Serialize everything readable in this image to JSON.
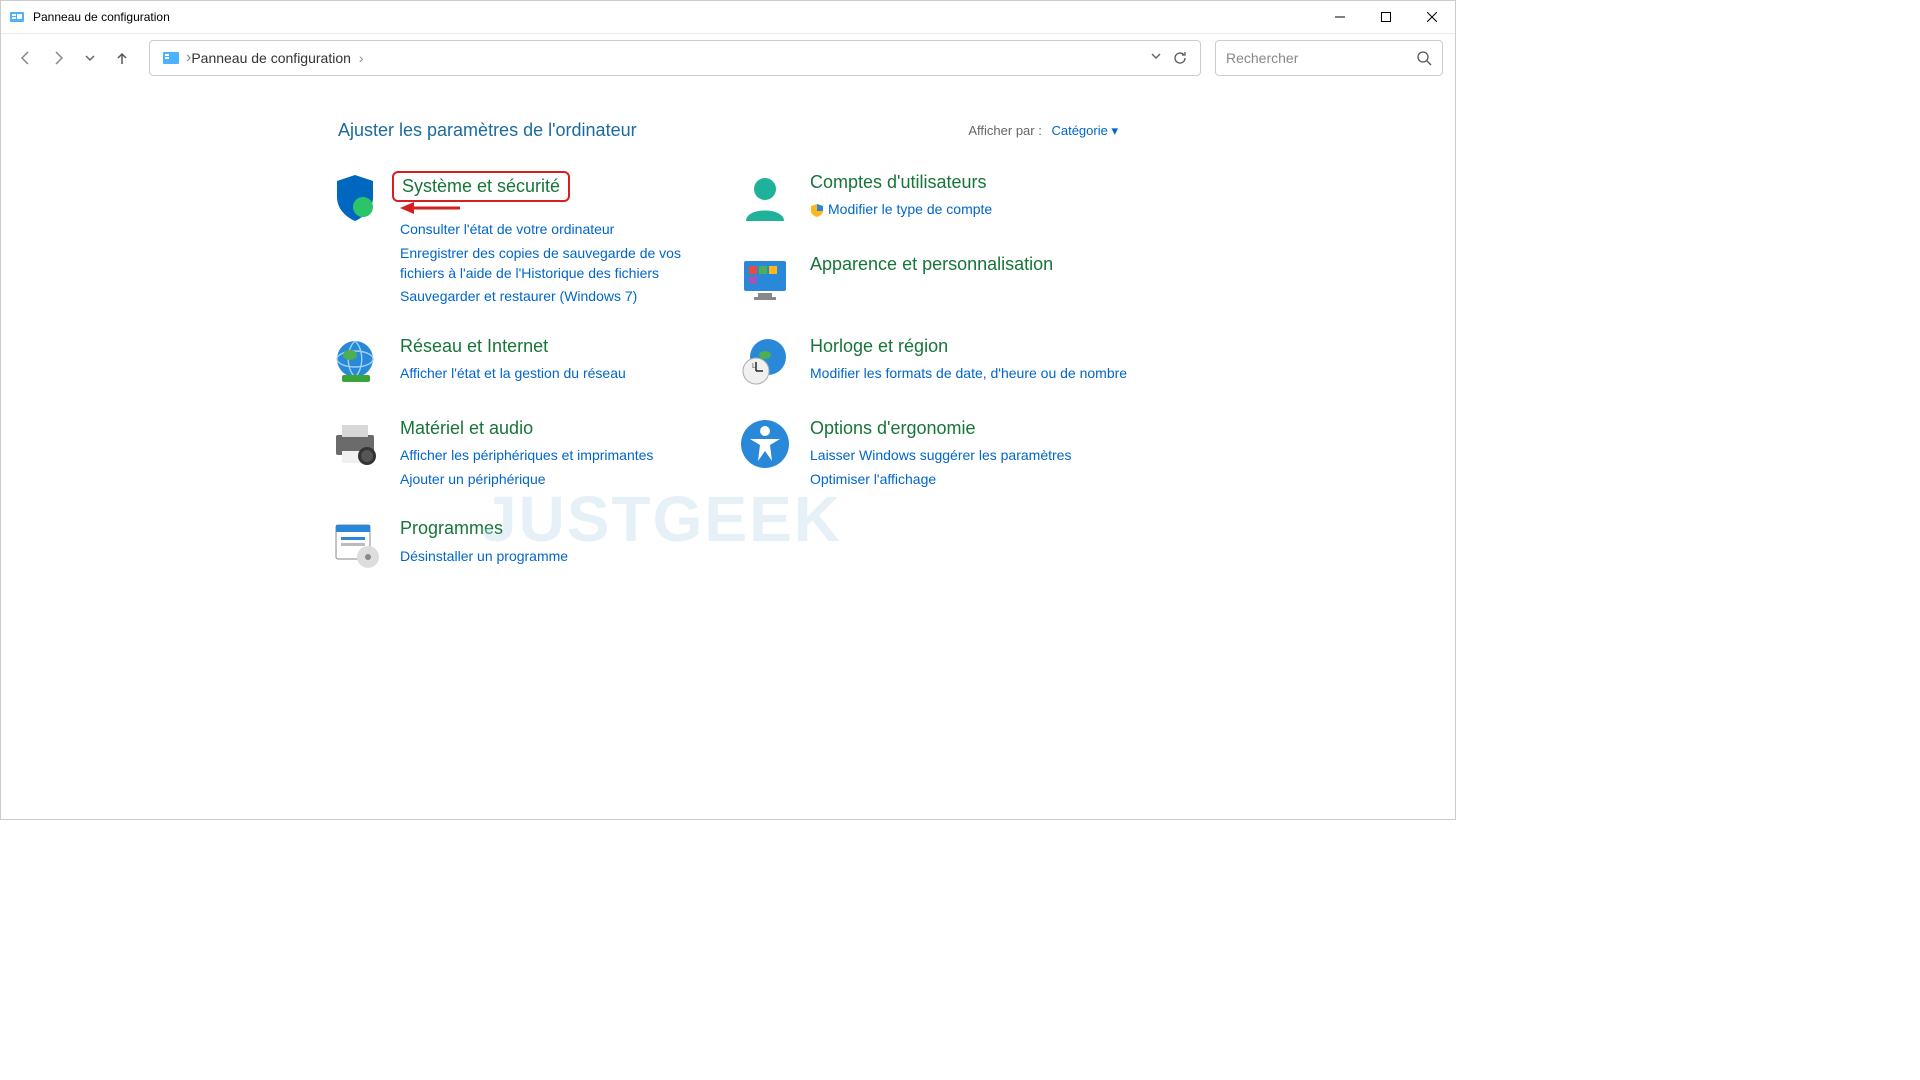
{
  "window": {
    "title": "Panneau de configuration"
  },
  "address": {
    "breadcrumb": "Panneau de configuration"
  },
  "search": {
    "placeholder": "Rechercher"
  },
  "header": {
    "heading": "Ajuster les paramètres de l'ordinateur",
    "view_label": "Afficher par :",
    "view_value": "Catégorie"
  },
  "left_col": {
    "system": {
      "title": "Système et sécurité",
      "links": [
        "Consulter l'état de votre ordinateur",
        "Enregistrer des copies de sauvegarde de vos fichiers à l'aide de l'Historique des fichiers",
        "Sauvegarder et restaurer (Windows 7)"
      ]
    },
    "network": {
      "title": "Réseau et Internet",
      "links": [
        "Afficher l'état et la gestion du réseau"
      ]
    },
    "hardware": {
      "title": "Matériel et audio",
      "links": [
        "Afficher les périphériques et imprimantes",
        "Ajouter un périphérique"
      ]
    },
    "programs": {
      "title": "Programmes",
      "links": [
        "Désinstaller un programme"
      ]
    }
  },
  "right_col": {
    "users": {
      "title": "Comptes d'utilisateurs",
      "links": [
        "Modifier le type de compte"
      ]
    },
    "appearance": {
      "title": "Apparence et personnalisation"
    },
    "clock": {
      "title": "Horloge et région",
      "links": [
        "Modifier les formats de date, d'heure ou de nombre"
      ]
    },
    "ease": {
      "title": "Options d'ergonomie",
      "links": [
        "Laisser Windows suggérer les paramètres",
        "Optimiser l'affichage"
      ]
    }
  },
  "watermark": "JUSTGEEK"
}
